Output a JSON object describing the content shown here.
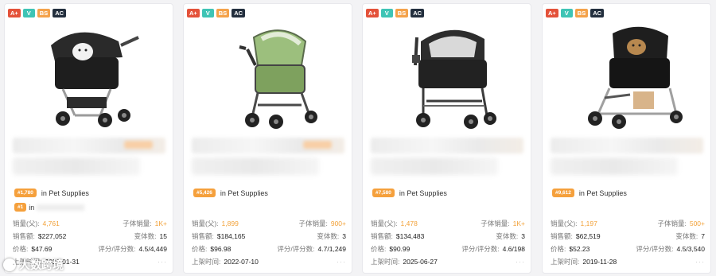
{
  "badges": [
    "A+",
    "V",
    "BS",
    "AC"
  ],
  "category_text": "in Pet Supplies",
  "labels": {
    "sales_parent": "销量(父):",
    "child_sales": "子体销量:",
    "revenue": "销售额:",
    "variants": "变体数:",
    "price": "价格:",
    "rating": "评分/评分数:",
    "listed": "上架时间:"
  },
  "products": [
    {
      "rank": "#1,780",
      "second_rank": "#1",
      "second_text": "in",
      "sales_parent": "4,761",
      "child_sales": "1K+",
      "revenue": "$227,052",
      "variants": "15",
      "price": "$47.69",
      "rating": "4.5/4,449",
      "listed": "2021-01-31"
    },
    {
      "rank": "#5,426",
      "sales_parent": "1,899",
      "child_sales": "900+",
      "revenue": "$184,165",
      "variants": "3",
      "price": "$96.98",
      "rating": "4.7/1,249",
      "listed": "2022-07-10"
    },
    {
      "rank": "#7,580",
      "sales_parent": "1,478",
      "child_sales": "1K+",
      "revenue": "$134,483",
      "variants": "3",
      "price": "$90.99",
      "rating": "4.6/198",
      "listed": "2025-06-27"
    },
    {
      "rank": "#9,612",
      "sales_parent": "1,197",
      "child_sales": "500+",
      "revenue": "$62,519",
      "variants": "7",
      "price": "$52.23",
      "rating": "4.5/3,540",
      "listed": "2019-11-28"
    }
  ],
  "more_dots": "···",
  "watermark": "大数跨境",
  "colors": {
    "accent_orange": "#f2a23a",
    "badge_aplus": "#e4523a",
    "badge_v": "#3ec4b5",
    "badge_bs": "#f4a24a",
    "badge_ac": "#232f3e"
  },
  "icons": [
    "dog-stroller-black-image",
    "stroller-green-image",
    "stroller-black-canopy-image",
    "stroller-black-dog-image",
    "watermark-logo-icon"
  ]
}
